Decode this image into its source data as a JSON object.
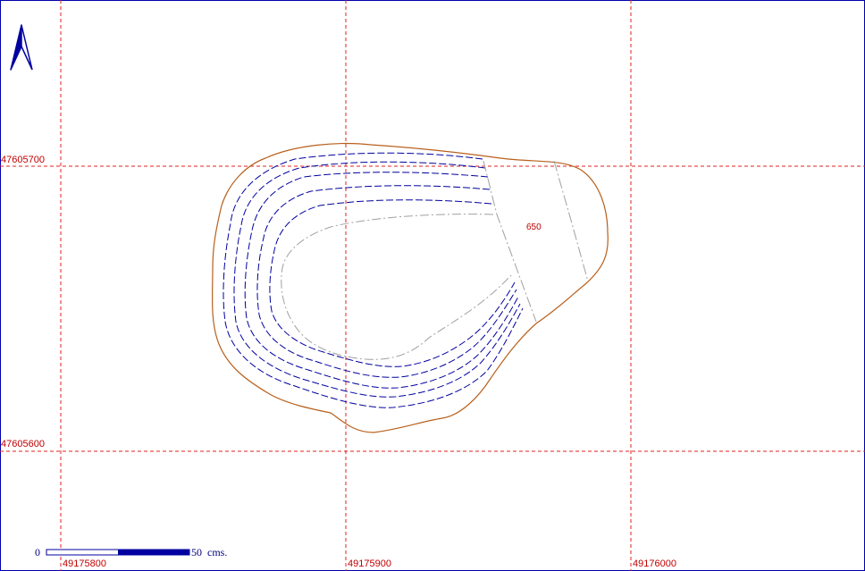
{
  "map": {
    "grid_x_labels": [
      "49175800",
      "49175900",
      "49176000"
    ],
    "grid_y_labels": [
      "47605700",
      "47605600"
    ],
    "contour_label": "650",
    "scale_bar": {
      "start_label": "0",
      "end_label": "50",
      "unit_label": "cms."
    }
  },
  "colors": {
    "grid": "#e02020",
    "boundary": "#b8601c",
    "contours": "#0000a0",
    "inner_contour": "#a0a0a0",
    "north_arrow": "#0000a0",
    "frame": "#0000aa"
  },
  "icons": {
    "north_arrow": "north-arrow-icon"
  }
}
